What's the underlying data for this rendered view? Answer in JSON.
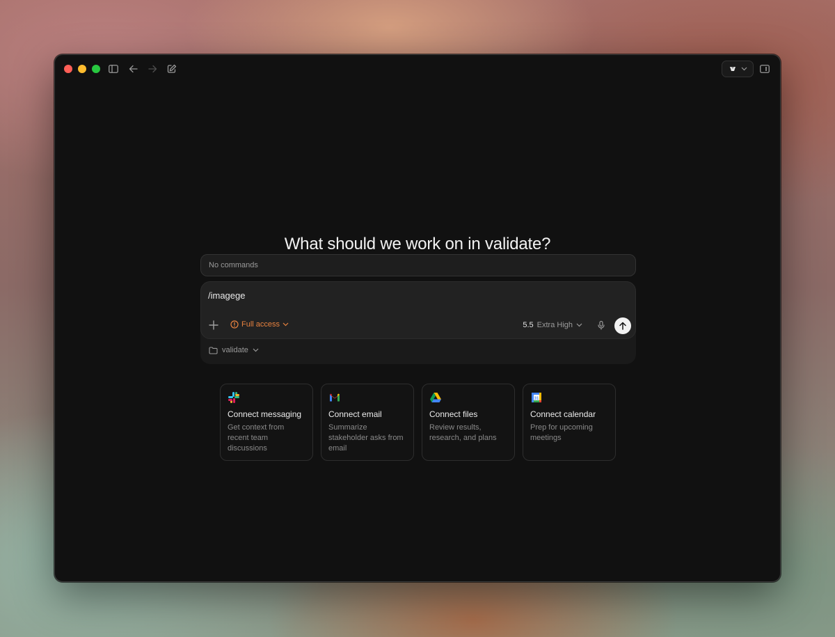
{
  "window": {
    "heading": "What should we work on in validate?"
  },
  "commands_hint": "No commands",
  "composer": {
    "input_value": "/imagege",
    "access_label": "Full access",
    "model_version": "5.5",
    "reasoning_level": "Extra High",
    "colors": {
      "access": "#e8823f",
      "send_bg": "#f2f2f2"
    }
  },
  "project": {
    "folder_label": "validate"
  },
  "connectors": [
    {
      "icon": "slack-icon",
      "title": "Connect messaging",
      "desc": "Get context from recent team discussions"
    },
    {
      "icon": "gmail-icon",
      "title": "Connect email",
      "desc": "Summarize stakeholder asks from email"
    },
    {
      "icon": "google-drive-icon",
      "title": "Connect files",
      "desc": "Review results, research, and plans"
    },
    {
      "icon": "google-calendar-icon",
      "title": "Connect calendar",
      "desc": "Prep for upcoming meetings",
      "icon_text": "31"
    }
  ]
}
